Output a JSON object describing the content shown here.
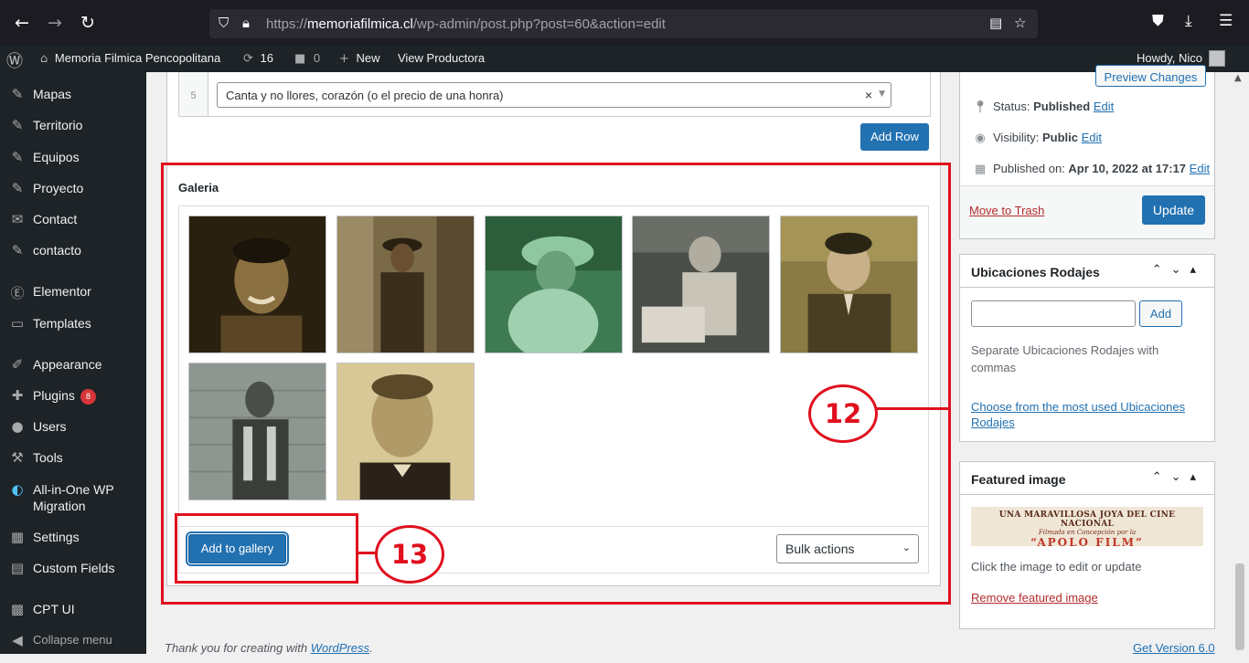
{
  "browser": {
    "url_prefix": "https://",
    "url_host": "memoriafilmica.cl",
    "url_path": "/wp-admin/post.php?post=60&action=edit"
  },
  "adminbar": {
    "site_name": "Memoria Filmica Pencopolitana",
    "updates": "16",
    "comments": "0",
    "new_label": "New",
    "view_label": "View Productora",
    "howdy": "Howdy, Nico"
  },
  "sidebar": {
    "items": [
      {
        "label": "Mapas",
        "icon": "pin-icon"
      },
      {
        "label": "Territorio",
        "icon": "pin-icon"
      },
      {
        "label": "Equipos",
        "icon": "pin-icon"
      },
      {
        "label": "Proyecto",
        "icon": "pin-icon"
      },
      {
        "label": "Contact",
        "icon": "mail-icon"
      },
      {
        "label": "contacto",
        "icon": "pin-icon"
      },
      {
        "label": "Elementor",
        "icon": "elementor-icon"
      },
      {
        "label": "Templates",
        "icon": "folder-icon"
      },
      {
        "label": "Appearance",
        "icon": "brush-icon"
      },
      {
        "label": "Plugins",
        "icon": "plugin-icon",
        "badge": "8"
      },
      {
        "label": "Users",
        "icon": "user-icon"
      },
      {
        "label": "Tools",
        "icon": "wrench-icon"
      },
      {
        "label": "All-in-One WP Migration",
        "icon": "migration-icon"
      },
      {
        "label": "Settings",
        "icon": "settings-icon"
      },
      {
        "label": "Custom Fields",
        "icon": "fields-icon"
      },
      {
        "label": "CPT UI",
        "icon": "cpt-icon"
      },
      {
        "label": "Collapse menu",
        "icon": "collapse-icon"
      }
    ]
  },
  "repeater": {
    "row_number": "5",
    "row_value": "Canta y no llores, corazón (o el precio de una honra)",
    "add_row": "Add Row"
  },
  "gallery": {
    "label": "Galeria",
    "add_button": "Add to gallery",
    "bulk_actions": "Bulk actions"
  },
  "annotations": {
    "a12": "12",
    "a13": "13"
  },
  "publish": {
    "preview": "Preview Changes",
    "status_label": "Status:",
    "status_value": "Published",
    "visibility_label": "Visibility:",
    "visibility_value": "Public",
    "published_label": "Published on:",
    "published_value": "Apr 10, 2022 at 17:17",
    "edit": "Edit",
    "trash": "Move to Trash",
    "update": "Update"
  },
  "ubicaciones": {
    "title": "Ubicaciones Rodajes",
    "add": "Add",
    "help": "Separate Ubicaciones Rodajes with commas",
    "choose": "Choose from the most used Ubicaciones Rodajes"
  },
  "featured": {
    "title": "Featured image",
    "img_line1": "UNA MARAVILLOSA JOYA DEL CINE NACIONAL",
    "img_line2": "Filmada en Concepción por la",
    "img_line3": "“APOLO FILM”",
    "help": "Click the image to edit or update",
    "remove": "Remove featured image"
  },
  "footer": {
    "thanks_prefix": "Thank you for creating with ",
    "thanks_link": "WordPress",
    "thanks_suffix": ".",
    "version": "Get Version 6.0"
  },
  "colors": {
    "admin_bar": "#1d2327",
    "primary": "#2271b1",
    "annotation": "#e0101e",
    "link_danger": "#b32d2e"
  }
}
